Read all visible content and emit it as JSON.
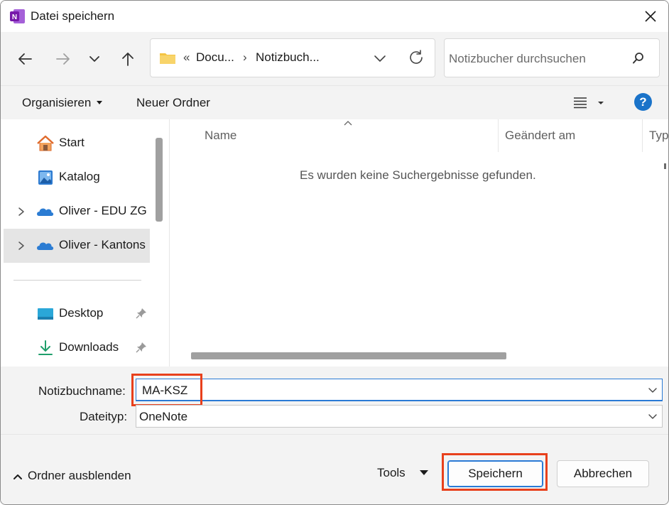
{
  "window": {
    "title": "Datei speichern",
    "app_icon": "onenote-icon",
    "close_icon": "close-icon"
  },
  "navigation": {
    "back_icon": "arrow-left-icon",
    "forward_icon": "arrow-right-icon",
    "recent_icon": "chevron-down-icon",
    "up_icon": "arrow-up-icon",
    "breadcrumb_overflow": "«",
    "breadcrumbs": [
      "Docu...",
      "Notizbuch..."
    ],
    "separator": "›",
    "refresh_icon": "refresh-icon",
    "search_placeholder": "Notizbucher durchsuchen",
    "search_icon": "search-icon"
  },
  "commandbar": {
    "organize_label": "Organisieren",
    "new_folder_label": "Neuer Ordner",
    "view_icon": "list-view-icon",
    "help_label": "?"
  },
  "sidebar": {
    "items": [
      {
        "label": "Start",
        "icon": "home-icon",
        "expandable": false,
        "pinned": false
      },
      {
        "label": "Katalog",
        "icon": "gallery-icon",
        "expandable": false,
        "pinned": false
      },
      {
        "label": "Oliver - EDU ZG",
        "icon": "onedrive-icon",
        "expandable": true,
        "pinned": false
      },
      {
        "label": "Oliver - Kantons",
        "icon": "onedrive-icon",
        "expandable": true,
        "pinned": false,
        "selected": true
      },
      {
        "label": "Desktop",
        "icon": "desktop-icon",
        "expandable": false,
        "pinned": true
      },
      {
        "label": "Downloads",
        "icon": "download-icon",
        "expandable": false,
        "pinned": true
      }
    ]
  },
  "content": {
    "columns": [
      "Name",
      "Geändert am",
      "Typ"
    ],
    "empty_message": "Es wurden keine Suchergebnisse gefunden."
  },
  "fields": {
    "name_label": "Notizbuchname:",
    "name_value": "MA-KSZ",
    "type_label": "Dateityp:",
    "type_value": "OneNote"
  },
  "footer": {
    "hide_folders_label": "Ordner ausblenden",
    "tools_label": "Tools",
    "save_label": "Speichern",
    "cancel_label": "Abbrechen"
  },
  "colors": {
    "accent": "#2a7ad5",
    "highlight": "#e8401c",
    "onenote": "#7719aa",
    "folder": "#f5c443",
    "onedrive": "#2b7cd3"
  }
}
